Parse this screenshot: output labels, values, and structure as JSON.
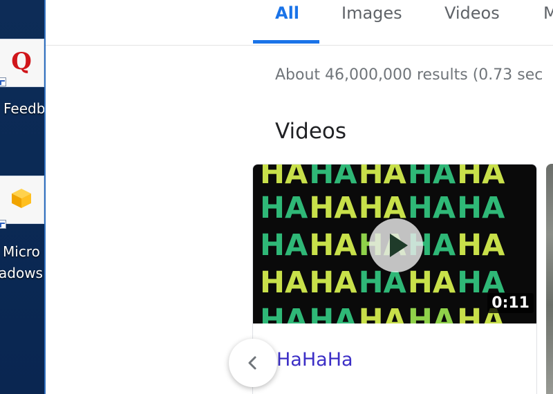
{
  "desktop": {
    "icons": [
      {
        "icon": "quora-q-icon",
        "label": "Feedb"
      },
      {
        "icon": "box-cube-icon",
        "label_line1": "Micro",
        "label_line2": "adows"
      }
    ],
    "q_glyph": "Q"
  },
  "search": {
    "tabs": [
      {
        "label": "All",
        "active": true
      },
      {
        "label": "Images",
        "active": false
      },
      {
        "label": "Videos",
        "active": false
      },
      {
        "label": "M",
        "active": false
      }
    ],
    "result_stats": "About 46,000,000 results (0.73 sec",
    "videos_heading": "Videos",
    "video": {
      "title": "HaHaHa",
      "duration": "0:11",
      "thumbnail_text": "HA"
    }
  },
  "colors": {
    "accent": "#1a73e8",
    "link": "#3c2fc6"
  }
}
